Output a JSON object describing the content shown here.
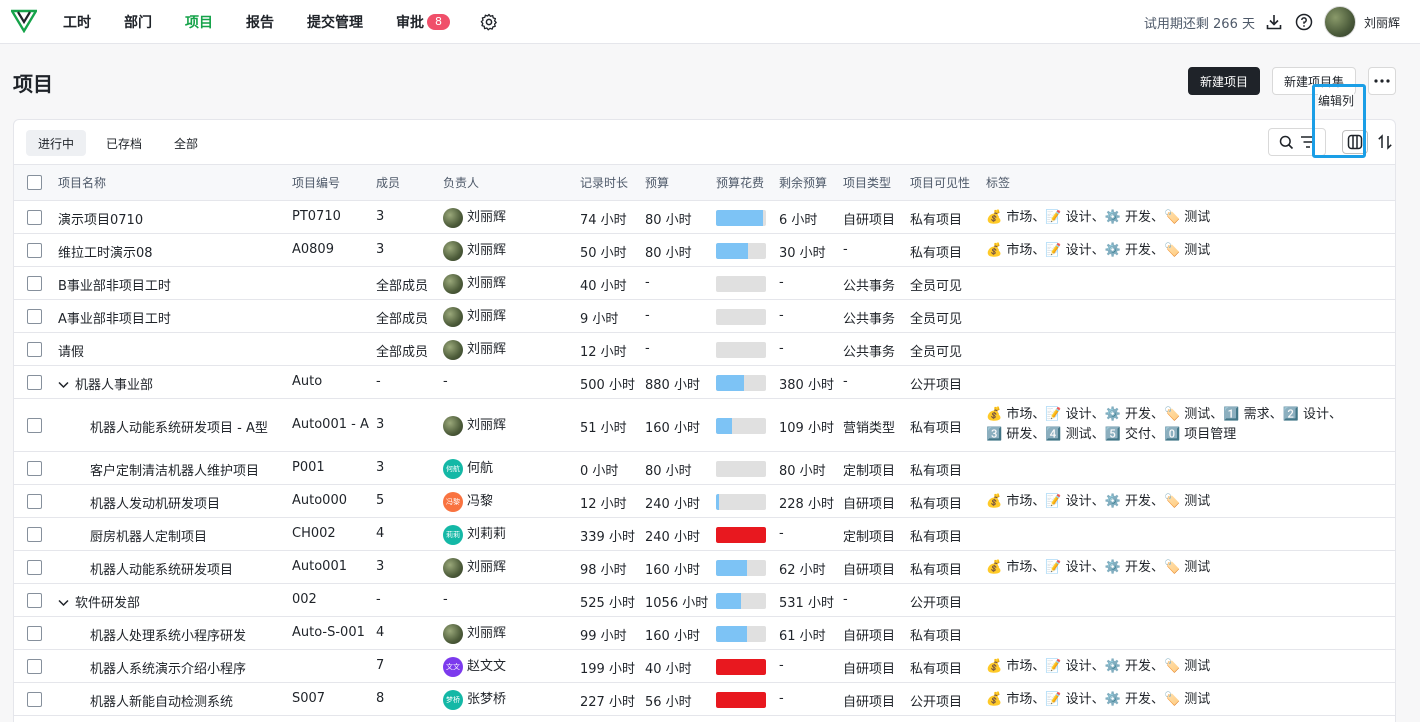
{
  "nav": {
    "items": [
      {
        "label": "工时",
        "active": false
      },
      {
        "label": "部门",
        "active": false
      },
      {
        "label": "项目",
        "active": true
      },
      {
        "label": "报告",
        "active": false
      },
      {
        "label": "提交管理",
        "active": false
      },
      {
        "label": "审批",
        "active": false,
        "badge": "8"
      }
    ],
    "trial": "试用期还剩 266 天",
    "username": "刘丽辉"
  },
  "page": {
    "title": "项目",
    "new_project": "新建项目",
    "new_project_set": "新建项目集"
  },
  "tabs": [
    {
      "label": "进行中",
      "active": true
    },
    {
      "label": "已存档",
      "active": false
    },
    {
      "label": "全部",
      "active": false
    }
  ],
  "tooltip": "编辑列",
  "columns": {
    "name": "项目名称",
    "code": "项目编号",
    "members": "成员",
    "owner": "负责人",
    "logged": "记录时长",
    "budget": "预算",
    "spend": "预算花费",
    "remaining": "剩余预算",
    "type": "项目类型",
    "visibility": "项目可见性",
    "tags": "标签"
  },
  "rows": [
    {
      "name": "演示项目0710",
      "indent": 0,
      "group": false,
      "code": "PT0710",
      "members": "3",
      "owner": "刘丽辉",
      "owner_avatar": "photo",
      "logged": "74 小时",
      "budget": "80 小时",
      "spend_pct": 0.93,
      "remaining": "6 小时",
      "type": "自研项目",
      "visibility": "私有项目",
      "tags": [
        "💰 市场、",
        "📝 设计、",
        "⚙️ 开发、",
        "🏷️ 测试"
      ],
      "tags2": []
    },
    {
      "name": "维拉工时演示08",
      "indent": 0,
      "group": false,
      "code": "A0809",
      "members": "3",
      "owner": "刘丽辉",
      "owner_avatar": "photo",
      "logged": "50 小时",
      "budget": "80 小时",
      "spend_pct": 0.63,
      "remaining": "30 小时",
      "type": "-",
      "visibility": "私有项目",
      "tags": [
        "💰 市场、",
        "📝 设计、",
        "⚙️ 开发、",
        "🏷️ 测试"
      ],
      "tags2": []
    },
    {
      "name": "B事业部非项目工时",
      "indent": 0,
      "group": false,
      "code": "",
      "members": "全部成员",
      "owner": "刘丽辉",
      "owner_avatar": "photo",
      "logged": "40 小时",
      "budget": "-",
      "spend_pct": 0,
      "remaining": "-",
      "type": "公共事务",
      "visibility": "全员可见",
      "tags": [],
      "tags2": []
    },
    {
      "name": "A事业部非项目工时",
      "indent": 0,
      "group": false,
      "code": "",
      "members": "全部成员",
      "owner": "刘丽辉",
      "owner_avatar": "photo",
      "logged": "9 小时",
      "budget": "-",
      "spend_pct": 0,
      "remaining": "-",
      "type": "公共事务",
      "visibility": "全员可见",
      "tags": [],
      "tags2": []
    },
    {
      "name": "请假",
      "indent": 0,
      "group": false,
      "code": "",
      "members": "全部成员",
      "owner": "刘丽辉",
      "owner_avatar": "photo",
      "logged": "12 小时",
      "budget": "-",
      "spend_pct": 0,
      "remaining": "-",
      "type": "公共事务",
      "visibility": "全员可见",
      "tags": [],
      "tags2": []
    },
    {
      "name": "机器人事业部",
      "indent": 0,
      "group": true,
      "code": "Auto",
      "members": "-",
      "owner": "-",
      "owner_avatar": "",
      "logged": "500 小时",
      "budget": "880 小时",
      "spend_pct": 0.57,
      "remaining": "380 小时",
      "type": "-",
      "visibility": "公开项目",
      "tags": [],
      "tags2": []
    },
    {
      "name": "机器人动能系统研发项目 - A型",
      "indent": 1,
      "group": false,
      "tall": true,
      "code": "Auto001 - A",
      "members": "3",
      "owner": "刘丽辉",
      "owner_avatar": "photo",
      "logged": "51 小时",
      "budget": "160 小时",
      "spend_pct": 0.32,
      "remaining": "109 小时",
      "type": "营销类型",
      "visibility": "私有项目",
      "tags": [
        "💰 市场、",
        "📝 设计、",
        "⚙️ 开发、",
        "🏷️ 测试、",
        "1️⃣ 需求、",
        "2️⃣ 设计、"
      ],
      "tags2": [
        "3️⃣ 研发、",
        "4️⃣ 测试、",
        "5️⃣ 交付、",
        "0️⃣ 项目管理"
      ]
    },
    {
      "name": "客户定制清洁机器人维护项目",
      "indent": 1,
      "group": false,
      "code": "P001",
      "members": "3",
      "owner": "何航",
      "owner_avatar": "何航",
      "owner_color": "#14b8a6",
      "logged": "0 小时",
      "budget": "80 小时",
      "spend_pct": 0,
      "remaining": "80 小时",
      "type": "定制项目",
      "visibility": "私有项目",
      "tags": [],
      "tags2": []
    },
    {
      "name": "机器人发动机研发项目",
      "indent": 1,
      "group": false,
      "code": "Auto000",
      "members": "5",
      "owner": "冯黎",
      "owner_avatar": "冯黎",
      "owner_color": "#f97340",
      "logged": "12 小时",
      "budget": "240 小时",
      "spend_pct": 0.05,
      "remaining": "228 小时",
      "type": "自研项目",
      "visibility": "私有项目",
      "tags": [
        "💰 市场、",
        "📝 设计、",
        "⚙️ 开发、",
        "🏷️ 测试"
      ],
      "tags2": []
    },
    {
      "name": "厨房机器人定制项目",
      "indent": 1,
      "group": false,
      "code": "CH002",
      "members": "4",
      "owner": "刘莉莉",
      "owner_avatar": "莉莉",
      "owner_color": "#14b8a6",
      "logged": "339 小时",
      "budget": "240 小时",
      "spend_pct": 1.0,
      "over": true,
      "remaining": "-",
      "type": "定制项目",
      "visibility": "私有项目",
      "tags": [],
      "tags2": []
    },
    {
      "name": "机器人动能系统研发项目",
      "indent": 1,
      "group": false,
      "code": "Auto001",
      "members": "3",
      "owner": "刘丽辉",
      "owner_avatar": "photo",
      "logged": "98 小时",
      "budget": "160 小时",
      "spend_pct": 0.61,
      "remaining": "62 小时",
      "type": "自研项目",
      "visibility": "私有项目",
      "tags": [
        "💰 市场、",
        "📝 设计、",
        "⚙️ 开发、",
        "🏷️ 测试"
      ],
      "tags2": []
    },
    {
      "name": "软件研发部",
      "indent": 0,
      "group": true,
      "code": "002",
      "members": "-",
      "owner": "-",
      "owner_avatar": "",
      "logged": "525 小时",
      "budget": "1056 小时",
      "spend_pct": 0.5,
      "remaining": "531 小时",
      "type": "-",
      "visibility": "公开项目",
      "tags": [],
      "tags2": []
    },
    {
      "name": "机器人处理系统小程序研发",
      "indent": 1,
      "group": false,
      "code": "Auto-S-001",
      "members": "4",
      "owner": "刘丽辉",
      "owner_avatar": "photo",
      "logged": "99 小时",
      "budget": "160 小时",
      "spend_pct": 0.62,
      "remaining": "61 小时",
      "type": "自研项目",
      "visibility": "私有项目",
      "tags": [],
      "tags2": []
    },
    {
      "name": "机器人系统演示介绍小程序",
      "indent": 1,
      "group": false,
      "code": "",
      "members": "7",
      "owner": "赵文文",
      "owner_avatar": "文文",
      "owner_color": "#7c3aed",
      "logged": "199 小时",
      "budget": "40 小时",
      "spend_pct": 1.0,
      "over": true,
      "remaining": "-",
      "type": "自研项目",
      "visibility": "私有项目",
      "tags": [
        "💰 市场、",
        "📝 设计、",
        "⚙️ 开发、",
        "🏷️ 测试"
      ],
      "tags2": []
    },
    {
      "name": "机器人新能自动检测系统",
      "indent": 1,
      "group": false,
      "code": "S007",
      "members": "8",
      "owner": "张梦桥",
      "owner_avatar": "梦桥",
      "owner_color": "#14b8a6",
      "logged": "227 小时",
      "budget": "56 小时",
      "spend_pct": 1.0,
      "over": true,
      "remaining": "-",
      "type": "自研项目",
      "visibility": "公开项目",
      "tags": [
        "💰 市场、",
        "📝 设计、",
        "⚙️ 开发、",
        "🏷️ 测试"
      ],
      "tags2": []
    }
  ]
}
